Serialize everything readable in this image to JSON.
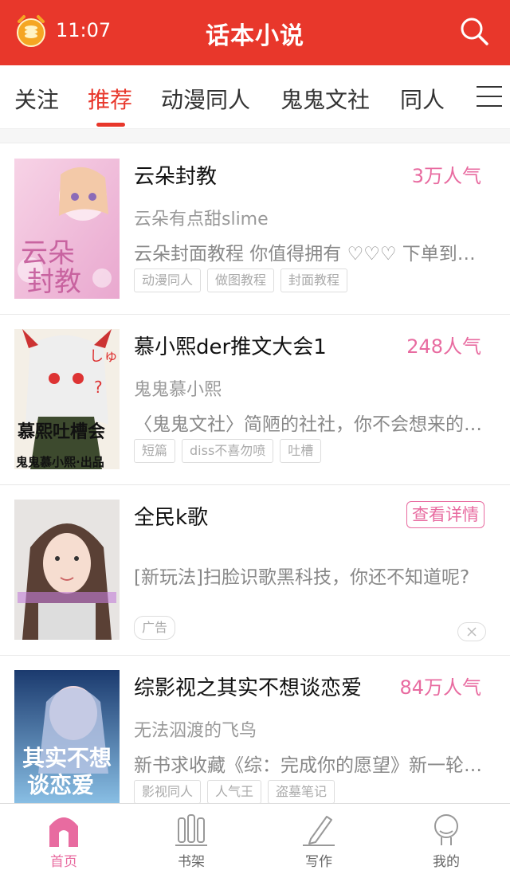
{
  "status": {
    "time": "11:07"
  },
  "header": {
    "title": "话本小说"
  },
  "tabs": [
    {
      "label": "关注"
    },
    {
      "label": "推荐"
    },
    {
      "label": "动漫同人"
    },
    {
      "label": "鬼鬼文社"
    },
    {
      "label": "同人"
    }
  ],
  "items": [
    {
      "title": "云朵封教",
      "popularity": "3万人气",
      "author": "云朵有点甜slime",
      "desc": "云朵封面教程 你值得拥有 ♡♡♡ 下单到…",
      "tags": [
        "动漫同人",
        "做图教程",
        "封面教程"
      ],
      "cover_text": "云朵封教"
    },
    {
      "title": "慕小熙der推文大会1",
      "popularity": "248人气",
      "author": "鬼鬼慕小熙",
      "desc": "〈鬼鬼文社〉简陋的社社，你不会想来的…",
      "tags": [
        "短篇",
        "diss不喜勿喷",
        "吐槽"
      ],
      "cover_text": "慕熙吐槽会",
      "cover_sub": "鬼鬼慕小熙·出品"
    },
    {
      "title": "全民k歌",
      "button": "查看详情",
      "desc": "[新玩法]扫脸识歌黑科技，你还不知道呢?",
      "ad_label": "广告"
    },
    {
      "title": "综影视之其实不想谈恋爱",
      "popularity": "84万人气",
      "author": "无法泅渡的飞鸟",
      "desc": "新书求收藏《综：完成你的愿望》新一轮…",
      "tags": [
        "影视同人",
        "人气王",
        "盗墓笔记"
      ],
      "cover_text": "其实不想谈恋爱"
    }
  ],
  "bottom_nav": [
    {
      "label": "首页",
      "icon": "home-icon"
    },
    {
      "label": "书架",
      "icon": "bookshelf-icon"
    },
    {
      "label": "写作",
      "icon": "pen-icon"
    },
    {
      "label": "我的",
      "icon": "profile-icon"
    }
  ],
  "colors": {
    "primary": "#e8372b",
    "accent_pink": "#e86ba0"
  }
}
